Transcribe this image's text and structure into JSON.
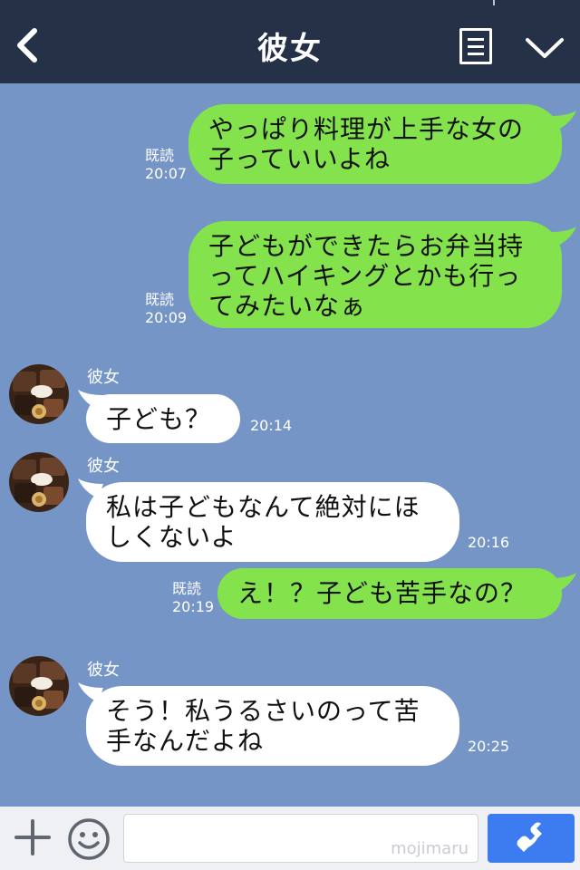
{
  "header": {
    "title": "彼女",
    "icons": [
      "back-icon",
      "menu-icon",
      "chevron-down-icon"
    ]
  },
  "messages": [
    {
      "from": "me",
      "lines": [
        "やっぱり料理が上手な女の",
        "子っていいよね"
      ],
      "read": "既読",
      "time": "20:07"
    },
    {
      "from": "me",
      "lines": [
        "子どもができたらお弁当持",
        "ってハイキングとかも行っ",
        "てみたいなぁ"
      ],
      "read": "既読",
      "time": "20:09"
    },
    {
      "from": "them",
      "sender": "彼女",
      "lines": [
        "子ども？"
      ],
      "time": "20:14"
    },
    {
      "from": "them",
      "sender": "彼女",
      "lines": [
        "私は子どもなんて絶対にほ",
        "しくないよ"
      ],
      "time": "20:16"
    },
    {
      "from": "me",
      "lines": [
        "え！？子ども苦手なの？"
      ],
      "read": "既読",
      "time": "20:19"
    },
    {
      "from": "them",
      "sender": "彼女",
      "lines": [
        "そう！私うるさいのって苦",
        "手なんだよね"
      ],
      "time": "20:25"
    }
  ],
  "inputbar": {
    "watermark": "mojimaru",
    "icons": [
      "plus-icon",
      "smile-icon",
      "phone-icon"
    ]
  },
  "colors": {
    "background": "#7595c6",
    "header": "#243146",
    "my_bubble": "#84e24c",
    "their_bubble": "#ffffff",
    "call_button": "#3d7cf0"
  }
}
